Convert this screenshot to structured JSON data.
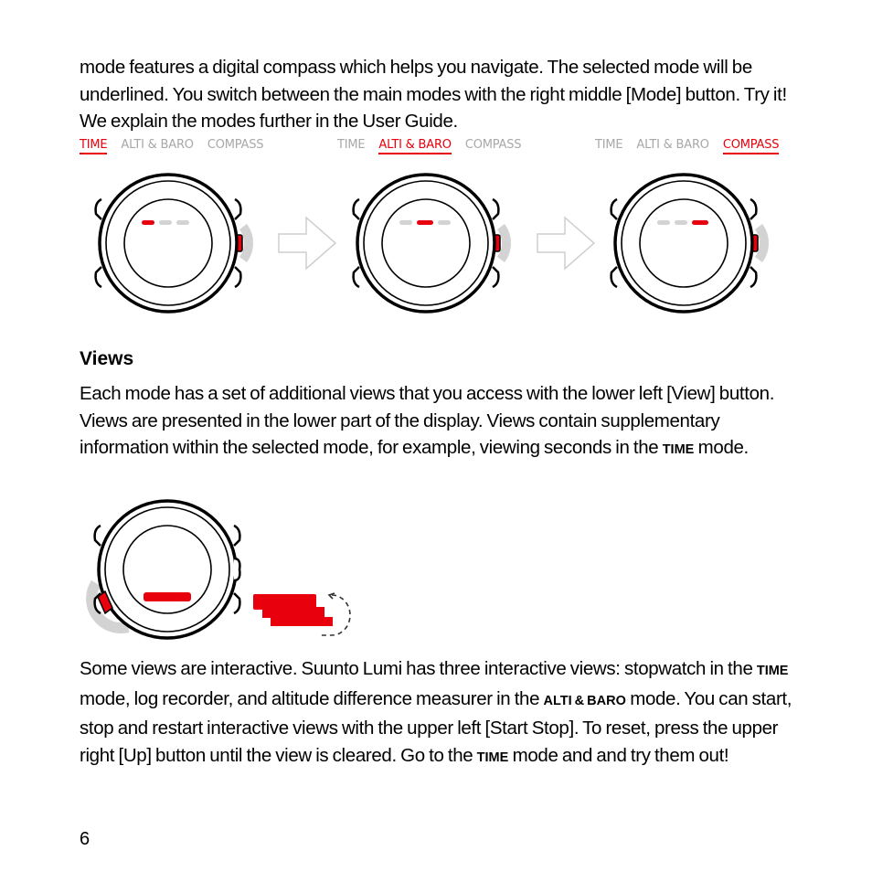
{
  "intro_paragraph": "mode features a digital compass which helps you navigate. The selected mode will be underlined. You switch between the main modes with the right middle [Mode] button. Try it! We explain the modes further in the User Guide.",
  "mode_figures": [
    {
      "labels": [
        "TIME",
        "ALTI & BARO",
        "COMPASS"
      ],
      "active": "TIME",
      "active_index": 0
    },
    {
      "labels": [
        "TIME",
        "ALTI & BARO",
        "COMPASS"
      ],
      "active": "ALTI & BARO",
      "active_index": 1
    },
    {
      "labels": [
        "TIME",
        "ALTI & BARO",
        "COMPASS"
      ],
      "active": "COMPASS",
      "active_index": 2
    }
  ],
  "views_section": {
    "heading": "Views",
    "paragraph_parts": {
      "a": "Each mode has a set of additional views that you access with the lower left [View] button. Views are presented in the lower part of the display. Views contain supplementary information within the selected mode, for example, viewing seconds in the ",
      "b": "TIME",
      "c": " mode."
    }
  },
  "interactive_paragraph_parts": {
    "a": "Some views are interactive. Suunto Lumi has three interactive views: stopwatch in the ",
    "b": "TIME",
    "c": " mode, log recorder, and altitude difference measurer in the ",
    "d": "ALTI & BARO",
    "e": " mode. You can start, stop and restart interactive views with the upper left [Start Stop]. To reset, press the upper right [Up] button until the view is cleared. Go to the ",
    "f": "TIME",
    "g": " mode and and try them out!"
  },
  "page_number": "6",
  "colors": {
    "accent_red": "#e8000d",
    "inactive_gray": "#a8a8a8",
    "press_arc_gray": "#d3d3d3",
    "arrow_gray": "#cfcfcf"
  }
}
